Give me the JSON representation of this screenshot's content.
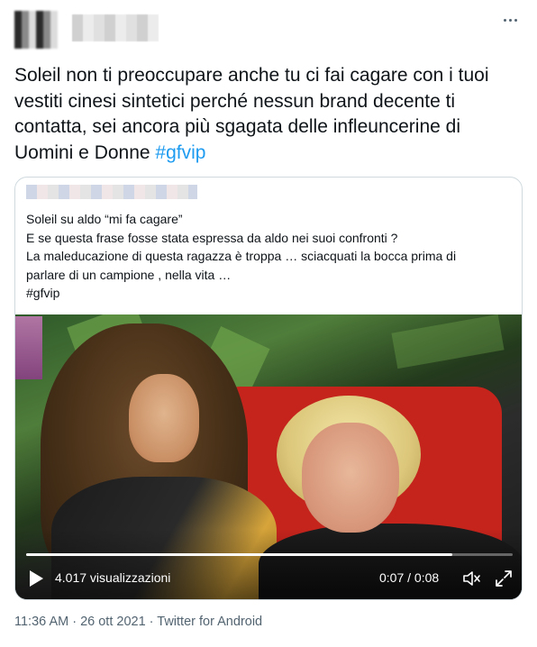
{
  "tweet": {
    "text_main": "Soleil non ti preoccupare anche tu ci fai cagare con i tuoi vestiti cinesi sintetici perché nessun brand decente ti contatta, sei ancora più sgagata delle infleuncerine di Uomini e Donne ",
    "hashtag": "#gfvip",
    "more_icon": "more-horizontal-icon"
  },
  "quote": {
    "lines": [
      "Soleil su aldo “mi fa cagare”",
      "E se questa frase fosse stata espressa  da aldo nei suoi confronti ?",
      "La maleducazione di questa ragazza è troppa … sciacquati la bocca prima di",
      "parlare di un campione , nella vita …",
      "#gfvip"
    ]
  },
  "video": {
    "views": "4.017 visualizzazioni",
    "time": "0:07 / 0:08",
    "progress": 0.875,
    "play_icon": "play-icon",
    "volume_icon": "volume-icon",
    "fullscreen_icon": "fullscreen-icon"
  },
  "meta": {
    "timestamp": "11:36 AM · 26 ott 2021 · Twitter for Android"
  },
  "colors": {
    "link": "#1d9bf0",
    "text": "#0f1419",
    "muted": "#536471",
    "border": "#cfd9de"
  }
}
